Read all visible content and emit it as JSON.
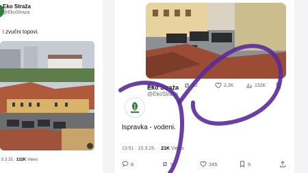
{
  "left_tweet": {
    "author_name": "Eko Straža",
    "handle": "@EkoStraza",
    "text": "i zvučni topovi.",
    "date_partial": "5.3.25.",
    "views_count": "132K",
    "views_label": "Views"
  },
  "right_tweet": {
    "author_name": "Eko Straža",
    "handle": "@EkoStraza",
    "text": "Ispravka - vodeni.",
    "timestamp": "13:51 · 15.3.25.",
    "views_count": "21K",
    "views_label": "Views",
    "embedded_actions": {
      "replies": "52",
      "reposts": "42",
      "likes": "2,2K",
      "views": "132K"
    },
    "actions": {
      "replies": "8",
      "reposts": "9",
      "likes": "245",
      "bookmarks": "5"
    }
  },
  "colors": {
    "annotation_stroke": "#5a2a9c",
    "avatar_green": "#2f7d38",
    "text_primary": "#111111",
    "text_secondary": "#5a6066"
  },
  "icons": [
    "reply-icon",
    "repost-icon",
    "like-icon",
    "views-icon",
    "bookmark-icon",
    "share-icon",
    "play-icon"
  ]
}
